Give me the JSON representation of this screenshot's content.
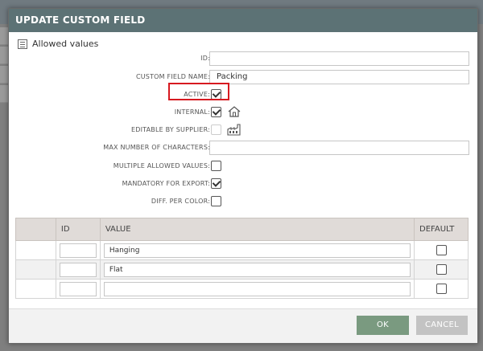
{
  "dialog": {
    "title": "UPDATE CUSTOM FIELD",
    "allowed_values_link": "Allowed values"
  },
  "fields": {
    "id": {
      "label": "ID:",
      "value": ""
    },
    "name": {
      "label": "CUSTOM FIELD NAME:",
      "value": "Packing"
    },
    "active": {
      "label": "ACTIVE:",
      "checked": true
    },
    "internal": {
      "label": "INTERNAL:",
      "checked": true,
      "icon": "house-icon"
    },
    "editable_by_supplier": {
      "label": "EDITABLE BY SUPPLIER:",
      "checked": false,
      "disabled": true,
      "icon": "factory-icon"
    },
    "max_chars": {
      "label": "MAX NUMBER OF CHARACTERS:",
      "value": ""
    },
    "multiple": {
      "label": "MULTIPLE ALLOWED VALUES:",
      "checked": false
    },
    "mandatory_export": {
      "label": "MANDATORY FOR EXPORT:",
      "checked": true
    },
    "diff_color": {
      "label": "DIFF. PER COLOR:",
      "checked": false
    }
  },
  "values_table": {
    "headers": {
      "id": "ID",
      "value": "VALUE",
      "default": "DEFAULT"
    },
    "rows": [
      {
        "id": "",
        "value": "Hanging",
        "default": false
      },
      {
        "id": "",
        "value": "Flat",
        "default": false
      },
      {
        "id": "",
        "value": "",
        "default": false
      }
    ]
  },
  "footer": {
    "ok_label": "OK",
    "cancel_label": "CANCEL"
  },
  "colors": {
    "header": "#5c7275",
    "ok": "#7a9a80",
    "cancel": "#c3c3c3",
    "highlight": "#d71920"
  }
}
